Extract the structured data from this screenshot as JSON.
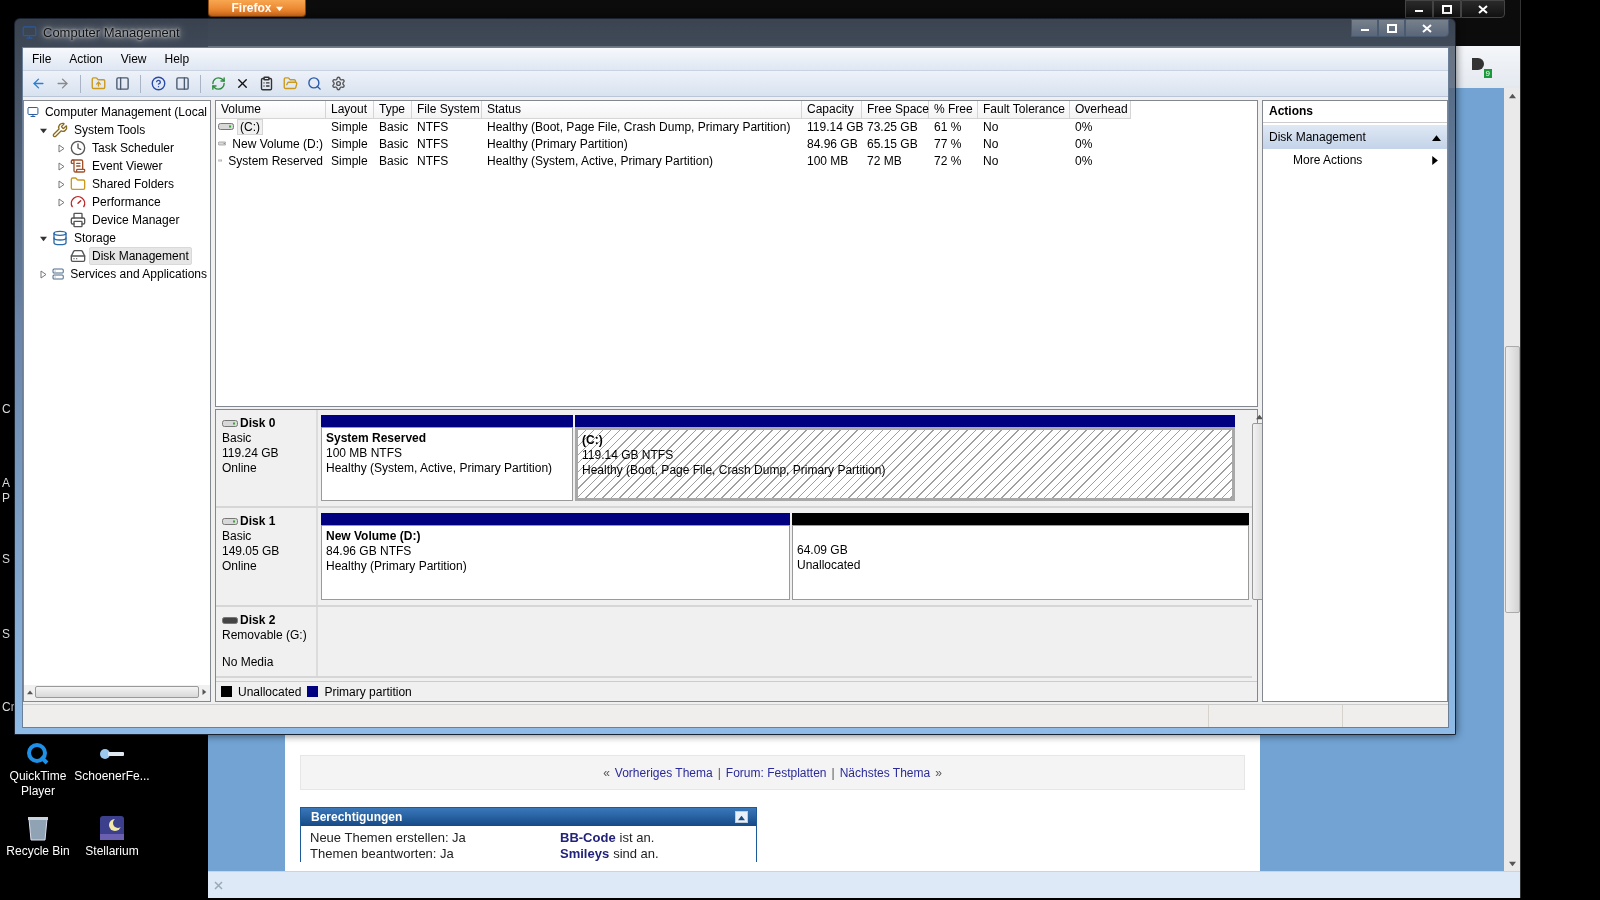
{
  "desktop": {
    "edge_letters": [
      "C",
      "A",
      "P",
      "S",
      "S",
      "Cr"
    ],
    "icons": [
      {
        "label": "QuickTime Player"
      },
      {
        "label": "SchoenerFe..."
      },
      {
        "label": "Recycle Bin"
      },
      {
        "label": "Stellarium"
      }
    ]
  },
  "browser": {
    "menu_button": "Firefox",
    "addon_badge": "9",
    "page": {
      "nav": [
        {
          "kind": "arrow",
          "text": "«"
        },
        {
          "kind": "link",
          "text": "Vorheriges Thema"
        },
        {
          "kind": "sep",
          "text": "|"
        },
        {
          "kind": "link",
          "text": "Forum: Festplatten"
        },
        {
          "kind": "sep",
          "text": "|"
        },
        {
          "kind": "link",
          "text": "Nächstes Thema"
        },
        {
          "kind": "arrow",
          "text": "»"
        }
      ],
      "permissions": {
        "title": "Berechtigungen",
        "expanded": true,
        "rows": [
          {
            "left": "Neue Themen erstellen: Ja",
            "link": "BB-Code",
            "rest": "ist an."
          },
          {
            "left": "Themen beantworten: Ja",
            "link": "Smileys",
            "rest": "sind an."
          }
        ]
      }
    }
  },
  "cm": {
    "title": "Computer Management",
    "menu": [
      "File",
      "Action",
      "View",
      "Help"
    ],
    "tree": [
      {
        "label": "Computer Management (Local",
        "selected": false,
        "children": [
          {
            "label": "System Tools",
            "kind": "branch",
            "expanded": true,
            "selected": false,
            "children": [
              {
                "label": "Task Scheduler",
                "kind": "branch",
                "expanded": false,
                "selected": false
              },
              {
                "label": "Event Viewer",
                "kind": "branch",
                "expanded": false,
                "selected": false
              },
              {
                "label": "Shared Folders",
                "kind": "branch",
                "expanded": false,
                "selected": false
              },
              {
                "label": "Performance",
                "kind": "branch",
                "expanded": false,
                "selected": false
              },
              {
                "label": "Device Manager",
                "kind": "leaf",
                "selected": false
              }
            ]
          },
          {
            "label": "Storage",
            "kind": "branch",
            "expanded": true,
            "selected": false,
            "children": [
              {
                "label": "Disk Management",
                "kind": "leaf",
                "selected": true
              }
            ]
          },
          {
            "label": "Services and Applications",
            "kind": "branch",
            "expanded": false,
            "selected": false
          }
        ]
      }
    ],
    "volumes": {
      "columns": [
        "Volume",
        "Layout",
        "Type",
        "File System",
        "Status",
        "Capacity",
        "Free Space",
        "% Free",
        "Fault Tolerance",
        "Overhead"
      ],
      "rows": [
        {
          "selected": true,
          "cells": [
            "(C:)",
            "Simple",
            "Basic",
            "NTFS",
            "Healthy (Boot, Page File, Crash Dump, Primary Partition)",
            "119.14 GB",
            "73.25 GB",
            "61 %",
            "No",
            "0%"
          ]
        },
        {
          "selected": false,
          "cells": [
            "New Volume (D:)",
            "Simple",
            "Basic",
            "NTFS",
            "Healthy (Primary Partition)",
            "84.96 GB",
            "65.15 GB",
            "77 %",
            "No",
            "0%"
          ]
        },
        {
          "selected": false,
          "cells": [
            "System Reserved",
            "Simple",
            "Basic",
            "NTFS",
            "Healthy (System, Active, Primary Partition)",
            "100 MB",
            "72 MB",
            "72 %",
            "No",
            "0%"
          ]
        }
      ]
    },
    "disks": [
      {
        "name": "Disk 0",
        "type": "Basic",
        "size": "119.24 GB",
        "status": "Online",
        "removable": false,
        "partitions": [
          {
            "kind": "primary",
            "name": "System Reserved",
            "detail": "100 MB NTFS",
            "status": "Healthy (System, Active, Primary Partition)",
            "selected": false
          },
          {
            "kind": "primary",
            "name": "(C:)",
            "detail": "119.14 GB NTFS",
            "status": "Healthy (Boot, Page File, Crash Dump, Primary Partition)",
            "selected": true
          }
        ]
      },
      {
        "name": "Disk 1",
        "type": "Basic",
        "size": "149.05 GB",
        "status": "Online",
        "removable": false,
        "partitions": [
          {
            "kind": "primary",
            "name": "New Volume  (D:)",
            "detail": "84.96 GB NTFS",
            "status": "Healthy (Primary Partition)",
            "selected": false
          },
          {
            "kind": "unallocated",
            "detail": "64.09 GB",
            "status": "Unallocated",
            "selected": false
          }
        ]
      },
      {
        "name": "Disk 2",
        "type": "Removable (G:)",
        "status": "No Media",
        "removable": true
      }
    ],
    "legend": [
      {
        "label": "Unallocated",
        "color": "#000000"
      },
      {
        "label": "Primary partition",
        "color": "#000080"
      }
    ],
    "actions": {
      "title": "Actions",
      "section": {
        "label": "Disk Management",
        "expanded": true
      },
      "items": [
        "More Actions"
      ]
    }
  }
}
